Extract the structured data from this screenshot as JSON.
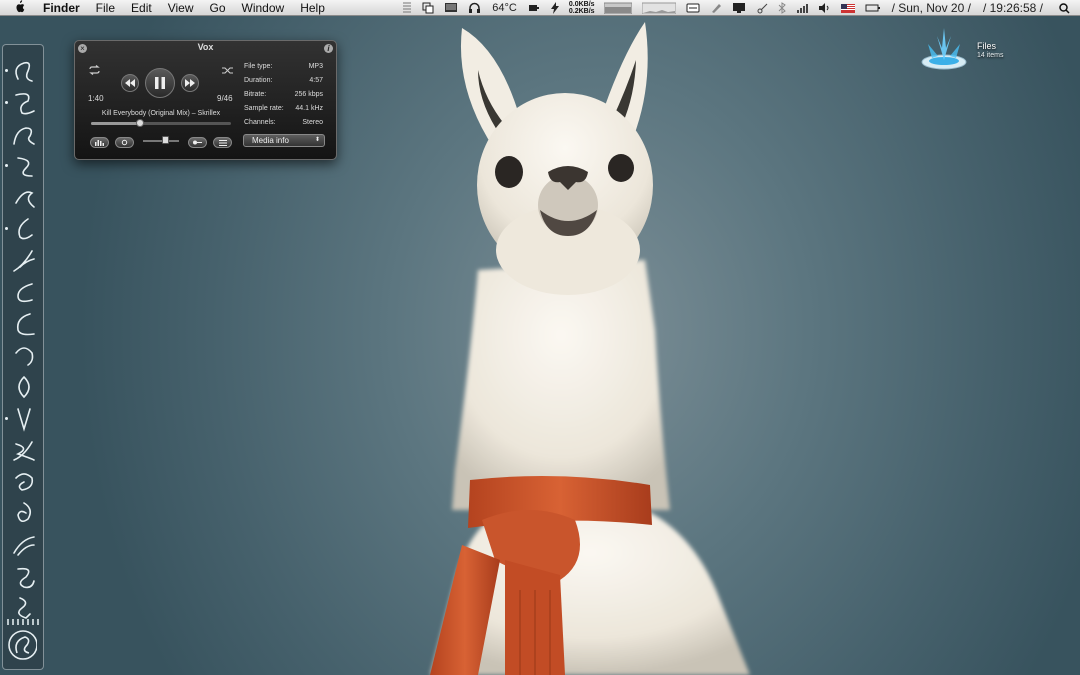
{
  "menubar": {
    "app_name": "Finder",
    "menus": [
      "File",
      "Edit",
      "View",
      "Go",
      "Window",
      "Help"
    ],
    "temperature": "64°C",
    "net_down": "0.0KB/s",
    "net_up": "0.2KB/s",
    "date": "/ Sun, Nov 20 /",
    "time": "/ 19:26:58 /",
    "icons": [
      "grid-icon",
      "windows-icon",
      "display-icon",
      "headphones-icon",
      "battery-icon",
      "bolt-icon",
      "memory-icon",
      "cpu-graph-icon",
      "disk-icon",
      "pen-icon",
      "monitor-icon",
      "scissors-icon",
      "bluetooth-icon",
      "signal-icon",
      "volume-icon",
      "flag-icon",
      "battery-outline-icon",
      "spotlight-icon"
    ]
  },
  "vox": {
    "title": "Vox",
    "elapsed": "1:40",
    "track_position": "9/46",
    "track_title": "Kill Everybody (Original Mix) – Skrillex",
    "progress": 0.35,
    "volume": 0.6,
    "media_button": "Media info",
    "props": [
      {
        "label": "File type:",
        "value": "MP3"
      },
      {
        "label": "Duration:",
        "value": "4:57"
      },
      {
        "label": "Bitrate:",
        "value": "256 kbps"
      },
      {
        "label": "Sample rate:",
        "value": "44.1 kHz"
      },
      {
        "label": "Channels:",
        "value": "Stereo"
      }
    ]
  },
  "files_widget": {
    "name": "Files",
    "count": "14 items"
  },
  "dock": {
    "items": [
      "swirl-1",
      "swirl-2",
      "swirl-3",
      "swirl-4",
      "swirl-5",
      "swirl-6",
      "swirl-7",
      "swirl-8",
      "swirl-9",
      "swirl-10",
      "swirl-11",
      "swirl-12",
      "swirl-13",
      "swirl-14",
      "swirl-15",
      "swirl-16",
      "swirl-17",
      "swirl-18"
    ],
    "running": [
      0,
      1,
      3,
      5,
      11
    ]
  },
  "colors": {
    "background": "#4f6b76",
    "scarf": "#c9552c",
    "llama": "#f4f1ea"
  }
}
